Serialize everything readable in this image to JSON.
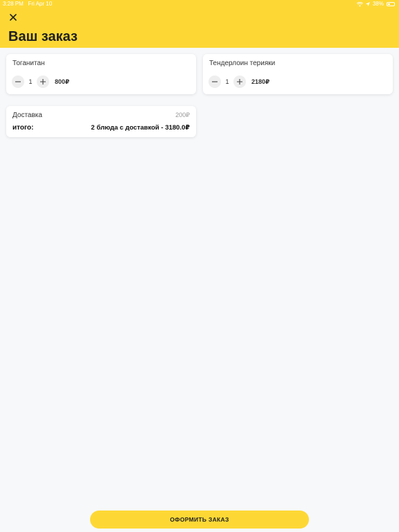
{
  "status_bar": {
    "time": "3:28 PM",
    "date": "Fri Apr 10",
    "battery": "38%"
  },
  "header": {
    "title": "Ваш заказ"
  },
  "items": [
    {
      "name": "Тоганитан",
      "quantity": "1",
      "price": "800₽"
    },
    {
      "name": "Тендерлоин терияки",
      "quantity": "1",
      "price": "2180₽"
    }
  ],
  "summary": {
    "delivery_label": "Доставка",
    "delivery_price": "200₽",
    "total_label": "итого:",
    "total_value": "2 блюда с доставкой - 3180.0₽"
  },
  "checkout": {
    "label": "ОФОРМИТЬ ЗАКАЗ"
  },
  "colors": {
    "accent": "#fdd835",
    "background": "#f7f8fa"
  }
}
